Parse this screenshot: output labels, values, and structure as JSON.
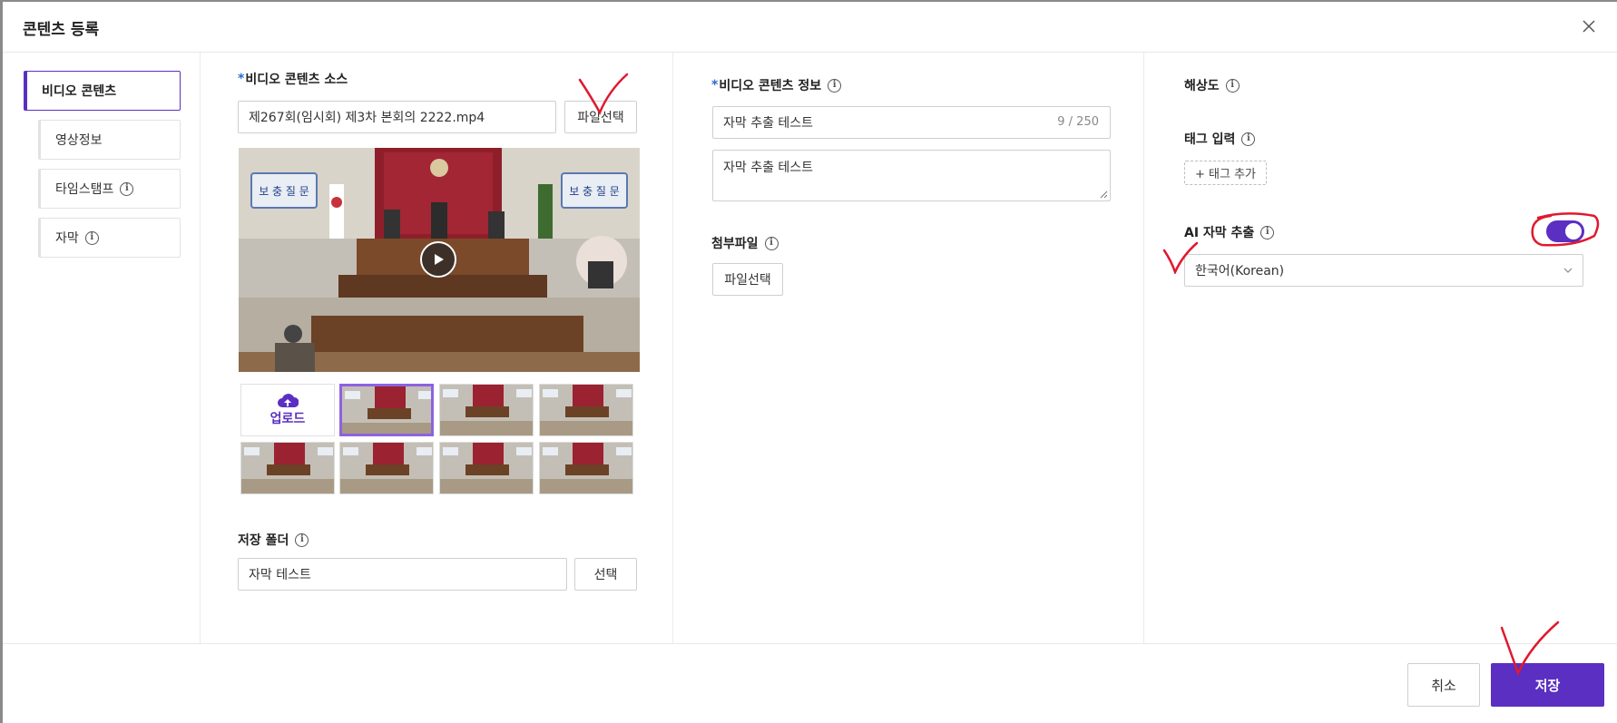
{
  "modal": {
    "title": "콘텐츠 등록"
  },
  "sidebar": {
    "items": [
      {
        "label": "비디오 콘텐츠"
      },
      {
        "label": "영상정보"
      },
      {
        "label": "타임스탬프"
      },
      {
        "label": "자막"
      }
    ]
  },
  "source": {
    "label": "비디오 콘텐츠 소스",
    "file_name": "제267회(임시회) 제3차 본회의 2222.mp4",
    "file_button": "파일선택",
    "video_sign_left": "보 충 질 문",
    "video_sign_right": "보 충 질 문",
    "upload_label": "업로드"
  },
  "folder": {
    "label": "저장 폴더",
    "value": "자막 테스트",
    "button": "선택"
  },
  "info": {
    "label": "비디오 콘텐츠 정보",
    "title_value": "자막 추출 테스트",
    "counter": "9 / 250",
    "description": "자막 추출 테스트"
  },
  "attachment": {
    "label": "첨부파일",
    "button": "파일선택"
  },
  "resolution": {
    "label": "해상도"
  },
  "tags": {
    "label": "태그 입력",
    "add_button": "+ 태그 추가"
  },
  "ai_subtitle": {
    "label": "AI 자막 추출",
    "enabled": true,
    "language": "한국어(Korean)"
  },
  "footer": {
    "cancel": "취소",
    "save": "저장"
  },
  "colors": {
    "accent": "#5a2fc2",
    "required": "#2a6bd1",
    "annotation": "#e0192e"
  }
}
